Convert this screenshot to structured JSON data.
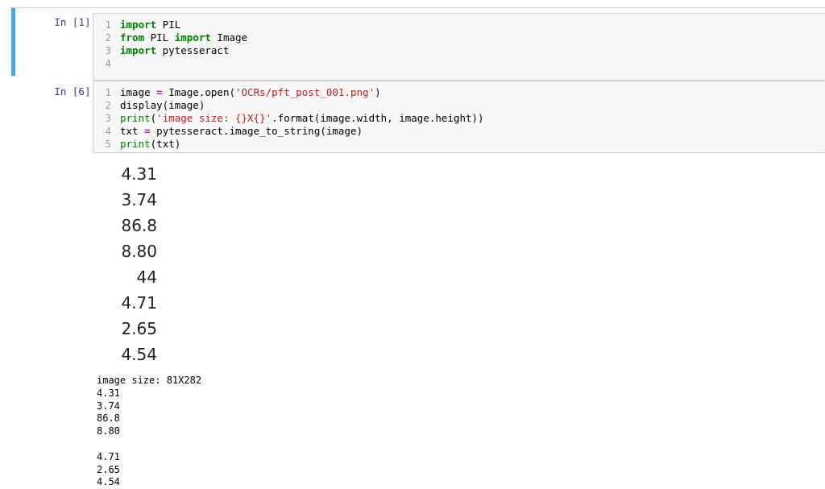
{
  "cells": [
    {
      "prompt": "In [1]:",
      "lines": [
        {
          "n": "1",
          "tokens": [
            {
              "t": "import",
              "c": "kw"
            },
            {
              "t": " PIL",
              "c": ""
            }
          ]
        },
        {
          "n": "2",
          "tokens": [
            {
              "t": "from",
              "c": "kw"
            },
            {
              "t": " PIL ",
              "c": ""
            },
            {
              "t": "import",
              "c": "kw"
            },
            {
              "t": " Image",
              "c": ""
            }
          ]
        },
        {
          "n": "3",
          "tokens": [
            {
              "t": "import",
              "c": "kw"
            },
            {
              "t": " pytesseract",
              "c": ""
            }
          ]
        },
        {
          "n": "4",
          "tokens": []
        }
      ]
    },
    {
      "prompt": "In [6]:",
      "lines": [
        {
          "n": "1",
          "tokens": [
            {
              "t": "image ",
              "c": ""
            },
            {
              "t": "=",
              "c": "op"
            },
            {
              "t": " Image.open(",
              "c": ""
            },
            {
              "t": "'OCRs/pft_post_001.png'",
              "c": "str"
            },
            {
              "t": ")",
              "c": ""
            }
          ]
        },
        {
          "n": "2",
          "tokens": [
            {
              "t": "display(image)",
              "c": ""
            }
          ]
        },
        {
          "n": "3",
          "tokens": [
            {
              "t": "print",
              "c": "fn"
            },
            {
              "t": "(",
              "c": ""
            },
            {
              "t": "'image size: {}X{}'",
              "c": "str"
            },
            {
              "t": ".format(image.width, image.height))",
              "c": ""
            }
          ]
        },
        {
          "n": "4",
          "tokens": [
            {
              "t": "txt ",
              "c": ""
            },
            {
              "t": "=",
              "c": "op"
            },
            {
              "t": " pytesseract.image_to_string(image)",
              "c": ""
            }
          ]
        },
        {
          "n": "5",
          "tokens": [
            {
              "t": "print",
              "c": "fn"
            },
            {
              "t": "(txt)",
              "c": ""
            }
          ]
        }
      ]
    }
  ],
  "display_image_values": [
    "4.31",
    "3.74",
    "86.8",
    "8.80",
    "44",
    "4.71",
    "2.65",
    "4.54"
  ],
  "stdout_lines": [
    "image size: 81X282",
    "4.31",
    "3.74",
    "86.8",
    "8.80",
    "",
    "4.71",
    "2.65",
    "4.54"
  ],
  "colors": {
    "selected_cell_bar": "#42a5f5",
    "prompt": "#303f9f",
    "keyword": "#008000",
    "string": "#ba2121",
    "operator": "#aa22ff"
  }
}
